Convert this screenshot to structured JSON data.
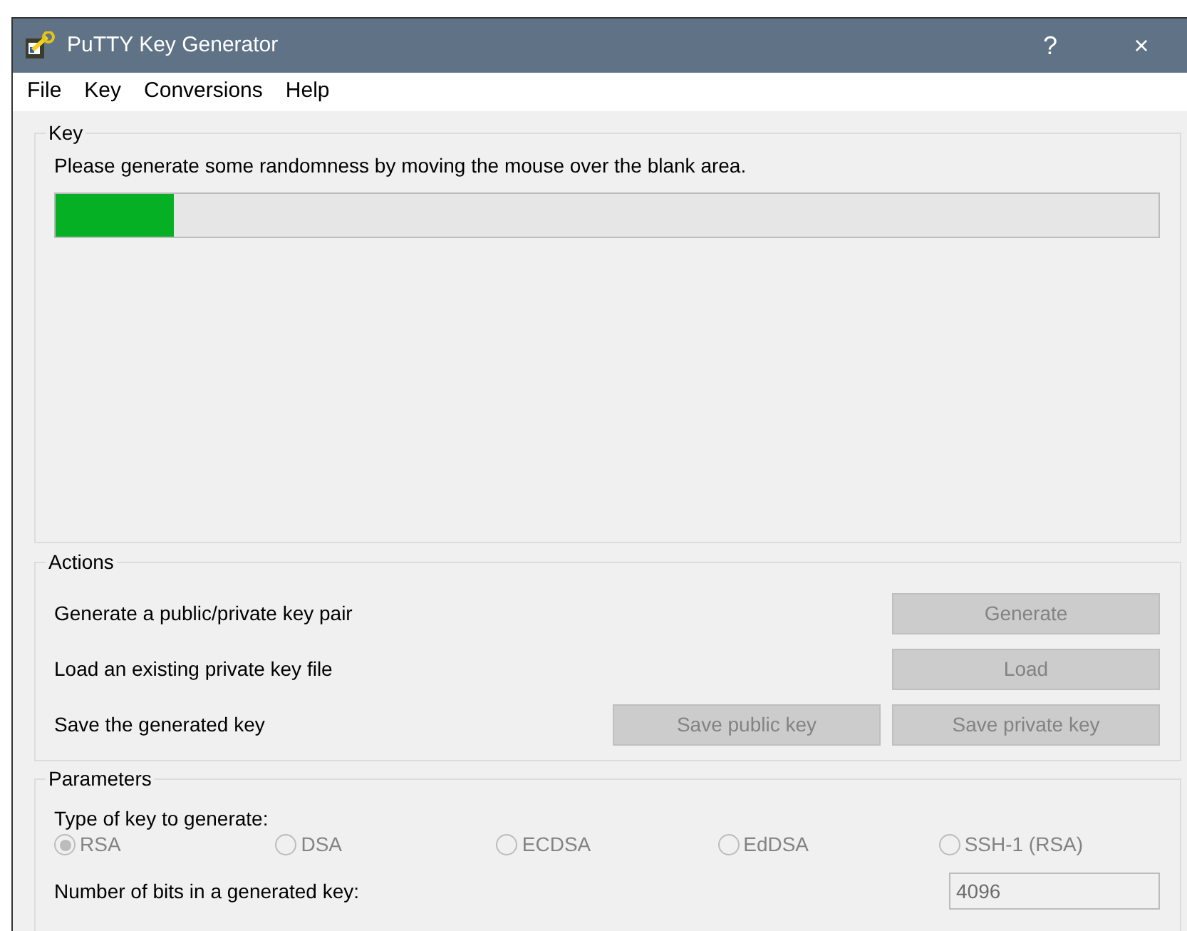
{
  "window": {
    "title": "PuTTY Key Generator",
    "title_buttons": [
      "?",
      "×"
    ]
  },
  "menu": [
    "File",
    "Key",
    "Conversions",
    "Help"
  ],
  "key_group": {
    "title": "Key",
    "instruction": "Please generate some randomness by moving the mouse over the blank area.",
    "progress": {
      "level": 0.107
    }
  },
  "actions": {
    "title": "Actions",
    "rows": [
      {
        "label": "Generate a public/private key pair",
        "buttons": [
          {
            "label": "Generate",
            "disabled": true
          }
        ]
      },
      {
        "label": "Load an existing private key file",
        "buttons": [
          {
            "label": "Load",
            "disabled": true
          }
        ]
      },
      {
        "label": "Save the generated key",
        "buttons": [
          {
            "label": "Save public key",
            "disabled": true
          },
          {
            "label": "Save private key",
            "disabled": true
          }
        ]
      }
    ]
  },
  "parameters": {
    "title": "Parameters",
    "type_label": "Type of key to generate:",
    "key_types": [
      {
        "label": "RSA",
        "selected": true,
        "disabled": true
      },
      {
        "label": "DSA",
        "selected": false,
        "disabled": true
      },
      {
        "label": "ECDSA",
        "selected": false,
        "disabled": true
      },
      {
        "label": "EdDSA",
        "selected": false,
        "disabled": true
      },
      {
        "label": "SSH-1 (RSA)",
        "selected": false,
        "disabled": true
      }
    ],
    "bits_label": "Number of bits in a generated key:",
    "bits": {
      "value": "4096",
      "disabled": true
    }
  }
}
